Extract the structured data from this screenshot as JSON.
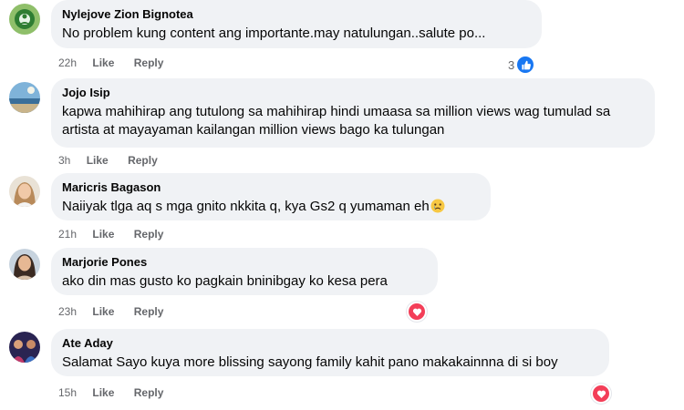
{
  "comments": [
    {
      "author": "Nylejove Zion Bignotea",
      "text": "No problem kung content ang importante.may natulungan..salute po...",
      "time": "22h",
      "like_label": "Like",
      "reply_label": "Reply",
      "reaction": {
        "type": "like",
        "count": "3"
      }
    },
    {
      "author": "Jojo Isip",
      "text": "kapwa mahihirap ang tutulong sa mahihirap hindi umaasa sa million views wag tumulad sa artista at mayayaman kailangan million views bago ka tulungan",
      "time": "3h",
      "like_label": "Like",
      "reply_label": "Reply"
    },
    {
      "author": "Maricris Bagason",
      "text": "Naiiyak tlga aq s mga gnito nkkita q, kya Gs2 q yumaman eh",
      "emoji": "crying-face-emoji",
      "time": "21h",
      "like_label": "Like",
      "reply_label": "Reply"
    },
    {
      "author": "Marjorie Pones",
      "text": "ako din mas gusto ko pagkain bninibgay ko kesa pera",
      "time": "23h",
      "like_label": "Like",
      "reply_label": "Reply",
      "reaction": {
        "type": "love"
      }
    },
    {
      "author": "Ate Aday",
      "text": "Salamat Sayo kuya more blissing sayong family kahit pano makakainnna di si boy",
      "time": "15h",
      "like_label": "Like",
      "reply_label": "Reply",
      "reaction": {
        "type": "love"
      }
    }
  ],
  "colors": {
    "bubble": "#f0f2f5",
    "meta_text": "#65676b",
    "like_blue": "#1877f2",
    "love_red": "#f33e58"
  },
  "icons": [
    "avatar",
    "like-reaction-icon",
    "love-reaction-icon",
    "crying-face-emoji"
  ]
}
